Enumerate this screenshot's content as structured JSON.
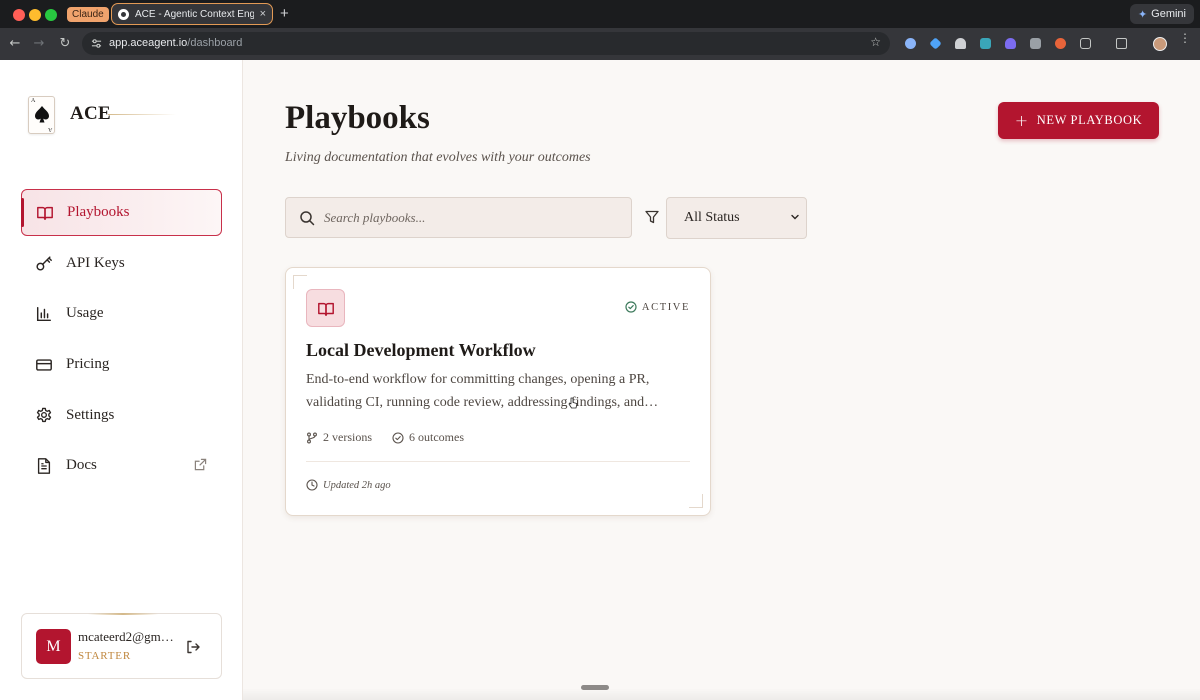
{
  "browser": {
    "pinned_tab_label": "Claude",
    "active_tab_title": "ACE - Agentic Context Engine",
    "url_host": "app.aceagent.io",
    "url_path": "/dashboard",
    "profile_button_label": "Gemini",
    "tab_close_glyph": "×",
    "new_tab_glyph": "+",
    "star_glyph": "☆",
    "back_glyph": "←",
    "forward_glyph": "→",
    "reload_glyph": "↻",
    "menu_glyph": "⋮",
    "gemini_glyph": "✦"
  },
  "sidebar": {
    "brand": "ACE",
    "logo_corner": "A",
    "nav": [
      {
        "label": "Playbooks",
        "icon": "book-open-icon",
        "active": true
      },
      {
        "label": "API Keys",
        "icon": "key-icon",
        "active": false
      },
      {
        "label": "Usage",
        "icon": "bar-chart-icon",
        "active": false
      },
      {
        "label": "Pricing",
        "icon": "credit-card-icon",
        "active": false
      },
      {
        "label": "Settings",
        "icon": "gear-icon",
        "active": false
      },
      {
        "label": "Docs",
        "icon": "document-icon",
        "active": false,
        "external": true
      }
    ],
    "account": {
      "initial": "M",
      "email": "mcateerd2@gm…",
      "plan": "STARTER"
    }
  },
  "main": {
    "title": "Playbooks",
    "subtitle": "Living documentation that evolves with your outcomes",
    "new_button_label": "NEW PLAYBOOK",
    "new_button_glyph": "+",
    "search_placeholder": "Search playbooks...",
    "status_filter": {
      "selected": "All Status"
    },
    "playbooks": [
      {
        "title": "Local Development Workflow",
        "status": "ACTIVE",
        "description": "End-to-end workflow for committing changes, opening a PR, validating CI, running code review, addressing findings, and…",
        "versions": "2 versions",
        "outcomes": "6 outcomes",
        "updated": "Updated 2h ago"
      }
    ]
  },
  "colors": {
    "accent": "#b3152f",
    "plan_gold": "#c0873e",
    "status_green": "#3d7a5c",
    "background": "#faf8f6"
  }
}
